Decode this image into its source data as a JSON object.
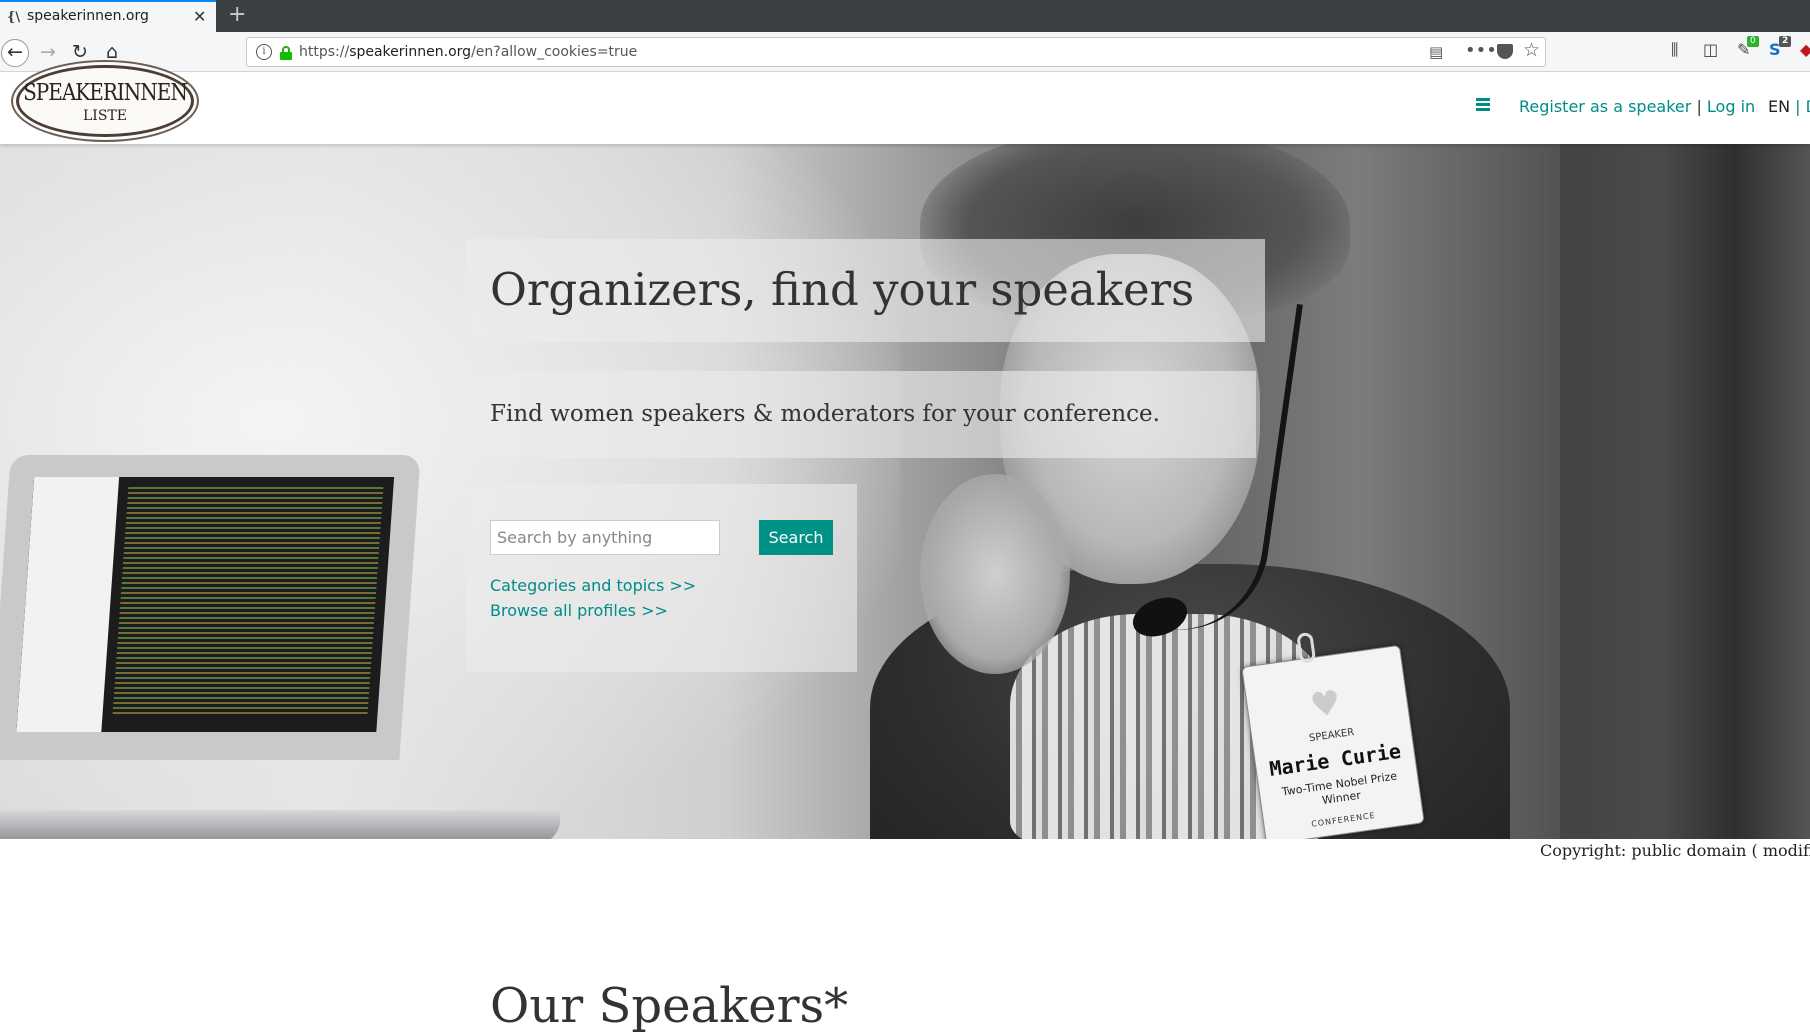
{
  "browser": {
    "tab": {
      "favicon": "{\\",
      "title": "speakerinnen.org",
      "close": "✕"
    },
    "new_tab": "+",
    "url_scheme": "https://",
    "url_host": "speakerinnen.org",
    "url_path": "/en?allow_cookies=true",
    "info": "i",
    "more": "•••",
    "badges": {
      "green": "0",
      "blue": "2"
    }
  },
  "header": {
    "logo_line1": "SPEAKERINNEN",
    "logo_line2": "LISTE",
    "register": "Register as a speaker",
    "separator": "|",
    "login": "Log in",
    "lang_current": "EN",
    "lang_sep": "|",
    "lang_next": "D"
  },
  "hero": {
    "title": "Organizers, find your speakers",
    "subtitle": "Find women speakers & moderators for your conference.",
    "search": {
      "placeholder": "Search by anything",
      "button": "Search",
      "link_categories": "Categories and topics >>",
      "link_browse": "Browse all profiles >>"
    },
    "badge": {
      "role": "SPEAKER",
      "name": "Marie Curie",
      "tagline": "Two-Time Nobel Prize Winner",
      "footer": "CONFERENCE"
    }
  },
  "copyright": "Copyright: public domain ( modifi",
  "section": {
    "title": "Our Speakers*"
  }
}
